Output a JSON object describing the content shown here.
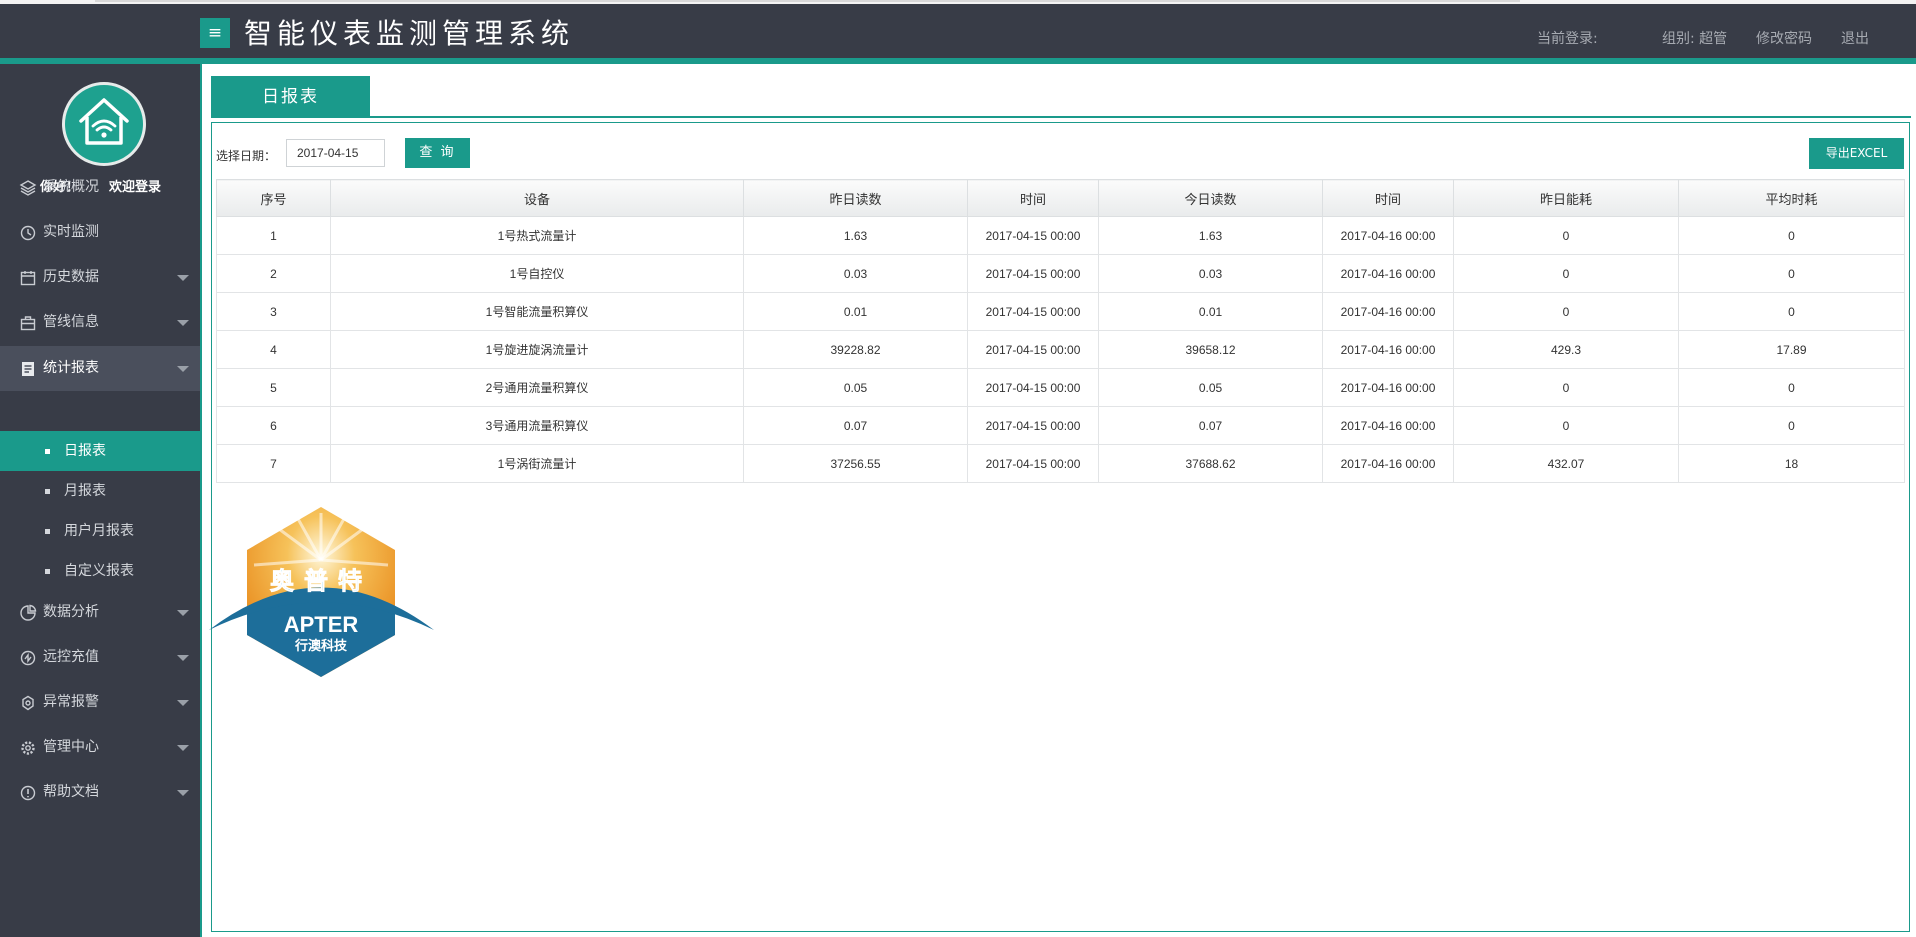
{
  "header": {
    "title": "智能仪表监测管理系统",
    "menu_toggle_icon": "≡",
    "login_label": "当前登录:",
    "group_label": "组别: 超管",
    "change_password": "修改密码",
    "logout": "退出"
  },
  "sidebar": {
    "greeting": "你好！",
    "welcome": "欢迎登录",
    "items": [
      {
        "label": "系统概况",
        "icon": "layers-icon",
        "has_caret": false
      },
      {
        "label": "实时监测",
        "icon": "history-icon",
        "has_caret": false
      },
      {
        "label": "历史数据",
        "icon": "calendar-icon",
        "has_caret": true
      },
      {
        "label": "管线信息",
        "icon": "briefcase-icon",
        "has_caret": true
      },
      {
        "label": "统计报表",
        "icon": "report-icon",
        "has_caret": true,
        "open": true
      },
      {
        "label": "数据分析",
        "icon": "chart-icon",
        "has_caret": true
      },
      {
        "label": "远控充值",
        "icon": "recharge-icon",
        "has_caret": true
      },
      {
        "label": "异常报警",
        "icon": "alarm-icon",
        "has_caret": true
      },
      {
        "label": "管理中心",
        "icon": "gear-icon",
        "has_caret": true
      },
      {
        "label": "帮助文档",
        "icon": "info-icon",
        "has_caret": true
      }
    ],
    "subitems": [
      {
        "label": "日报表",
        "active": true
      },
      {
        "label": "月报表",
        "active": false
      },
      {
        "label": "用户月报表",
        "active": false
      },
      {
        "label": "自定义报表",
        "active": false
      }
    ]
  },
  "tab": {
    "label": "日报表"
  },
  "filter": {
    "date_label": "选择日期：",
    "date_value": "2017-04-15",
    "query_label": "查 询",
    "export_label": "导出EXCEL"
  },
  "table": {
    "headers": [
      "序号",
      "设备",
      "昨日读数",
      "时间",
      "今日读数",
      "时间",
      "昨日能耗",
      "平均时耗"
    ],
    "rows": [
      [
        "1",
        "1号热式流量计",
        "1.63",
        "2017-04-15 00:00",
        "1.63",
        "2017-04-16 00:00",
        "0",
        "0"
      ],
      [
        "2",
        "1号自控仪",
        "0.03",
        "2017-04-15 00:00",
        "0.03",
        "2017-04-16 00:00",
        "0",
        "0"
      ],
      [
        "3",
        "1号智能流量积算仪",
        "0.01",
        "2017-04-15 00:00",
        "0.01",
        "2017-04-16 00:00",
        "0",
        "0"
      ],
      [
        "4",
        "1号旋进旋涡流量计",
        "39228.82",
        "2017-04-15 00:00",
        "39658.12",
        "2017-04-16 00:00",
        "429.3",
        "17.89"
      ],
      [
        "5",
        "2号通用流量积算仪",
        "0.05",
        "2017-04-15 00:00",
        "0.05",
        "2017-04-16 00:00",
        "0",
        "0"
      ],
      [
        "6",
        "3号通用流量积算仪",
        "0.07",
        "2017-04-15 00:00",
        "0.07",
        "2017-04-16 00:00",
        "0",
        "0"
      ],
      [
        "7",
        "1号涡街流量计",
        "37256.55",
        "2017-04-15 00:00",
        "37688.62",
        "2017-04-16 00:00",
        "432.07",
        "18"
      ]
    ]
  },
  "logo": {
    "top_text": "奥普特",
    "brand": "APTER",
    "company": "行澳科技",
    "colors": {
      "orange": "#f0a23a",
      "blue": "#1d6e9a",
      "text_blue": "#3db8e8"
    }
  },
  "colors": {
    "accent": "#1a9a8b",
    "header_bg": "#383c47",
    "sidebar_bg": "#383c47"
  }
}
